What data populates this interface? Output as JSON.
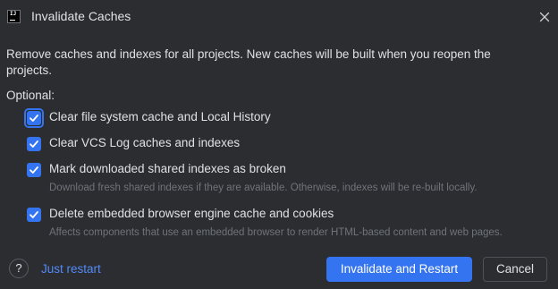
{
  "window": {
    "title": "Invalidate Caches",
    "app_icon_glyph": "IJ",
    "app_icon": "intellij-app-icon",
    "close_icon": "close-icon"
  },
  "description": "Remove caches and indexes for all projects. New caches will be built when you reopen the projects.",
  "optional_label": "Optional:",
  "options": [
    {
      "label": "Clear file system cache and Local History",
      "checked": true,
      "focused": true,
      "hint": ""
    },
    {
      "label": "Clear VCS Log caches and indexes",
      "checked": true,
      "focused": false,
      "hint": ""
    },
    {
      "label": "Mark downloaded shared indexes as broken",
      "checked": true,
      "focused": false,
      "hint": "Download fresh shared indexes if they are available. Otherwise, indexes will be re-built locally."
    },
    {
      "label": "Delete embedded browser engine cache and cookies",
      "checked": true,
      "focused": false,
      "hint": "Affects components that use an embedded browser to render HTML-based content and web pages."
    }
  ],
  "footer": {
    "help_label": "?",
    "just_restart_label": "Just restart",
    "primary_label": "Invalidate and Restart",
    "cancel_label": "Cancel"
  },
  "colors": {
    "background": "#2b2d30",
    "text": "#dfe1e5",
    "hint_text": "#6f737a",
    "accent": "#3574f0",
    "link": "#548af7"
  }
}
